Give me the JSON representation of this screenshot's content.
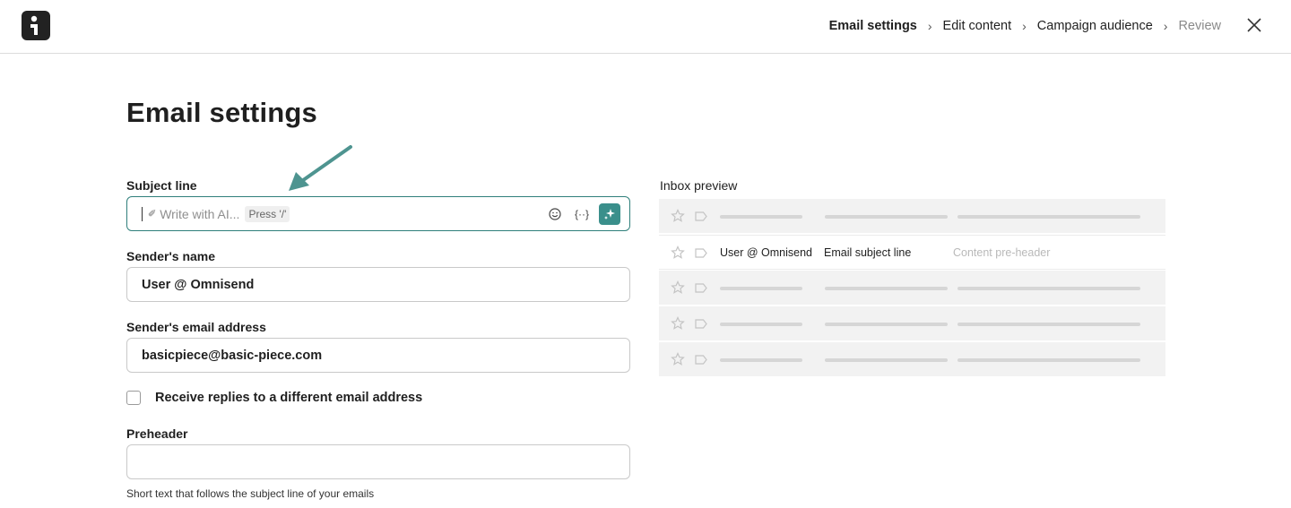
{
  "header": {
    "breadcrumb": [
      {
        "label": "Email settings",
        "state": "active"
      },
      {
        "label": "Edit content",
        "state": "default"
      },
      {
        "label": "Campaign audience",
        "state": "default"
      },
      {
        "label": "Review",
        "state": "muted"
      }
    ],
    "separator": "›"
  },
  "page": {
    "title": "Email settings"
  },
  "form": {
    "subject": {
      "label": "Subject line",
      "placeholder": "Write with AI...",
      "press_hint": "Press '/'",
      "personalization": "{··}"
    },
    "sender_name": {
      "label": "Sender's name",
      "value": "User @ Omnisend"
    },
    "sender_email": {
      "label": "Sender's email address",
      "value": "basicpiece@basic-piece.com"
    },
    "replies_checkbox": {
      "label": "Receive replies to a different email address",
      "checked": false
    },
    "preheader": {
      "label": "Preheader",
      "value": "",
      "helper": "Short text that follows the subject line of your emails"
    }
  },
  "preview": {
    "label": "Inbox preview",
    "highlight_row": {
      "sender": "User @ Omnisend",
      "subject": "Email subject line",
      "preheader": "Content pre-header"
    }
  },
  "colors": {
    "accent": "#3a8f8b",
    "focus_border": "#2f7f7b",
    "arrow": "#4e9490"
  }
}
